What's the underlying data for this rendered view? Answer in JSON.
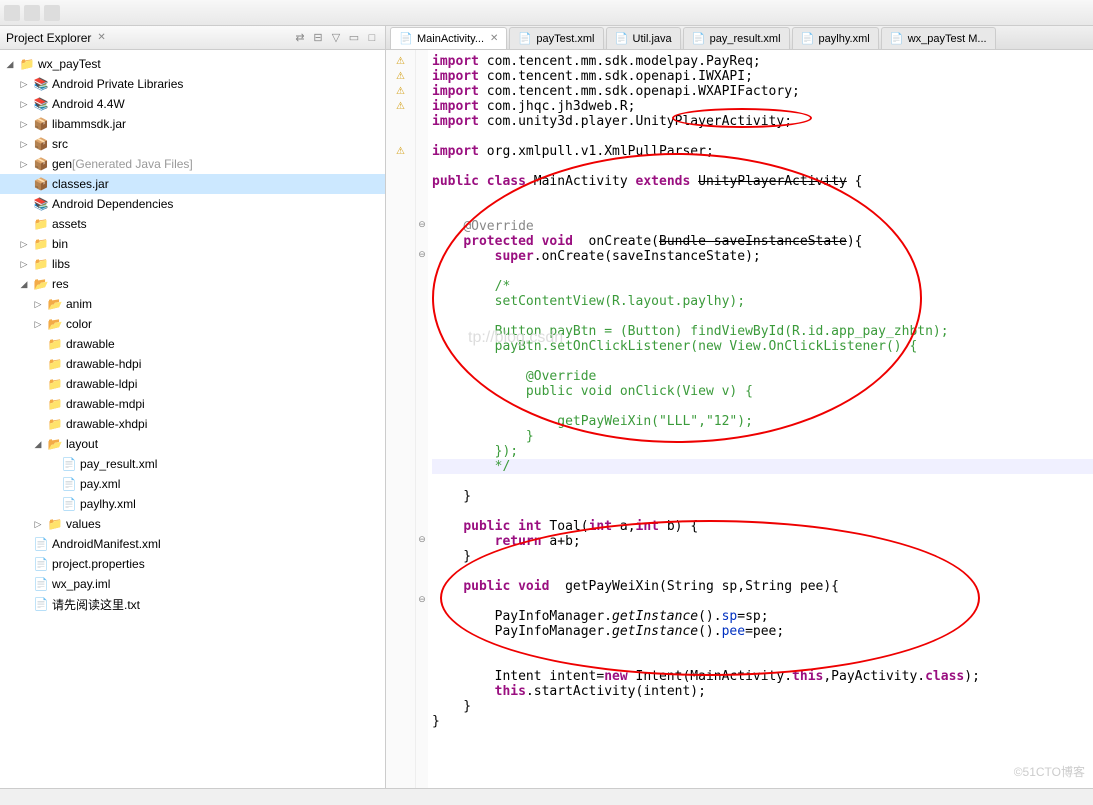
{
  "explorer": {
    "title": "Project Explorer",
    "project": "wx_payTest",
    "items": [
      {
        "label": "Android Private Libraries",
        "indent": 1,
        "toggle": "▷",
        "icon": "📚"
      },
      {
        "label": "Android 4.4W",
        "indent": 1,
        "toggle": "▷",
        "icon": "📚"
      },
      {
        "label": "libammsdk.jar",
        "indent": 1,
        "toggle": "▷",
        "icon": "📦"
      },
      {
        "label": "src",
        "indent": 1,
        "toggle": "▷",
        "icon": "📦"
      },
      {
        "label": "gen",
        "extra": "[Generated Java Files]",
        "indent": 1,
        "toggle": "▷",
        "icon": "📦"
      },
      {
        "label": "classes.jar",
        "indent": 1,
        "toggle": " ",
        "icon": "📦",
        "selected": true
      },
      {
        "label": "Android Dependencies",
        "indent": 1,
        "toggle": " ",
        "icon": "📚"
      },
      {
        "label": "assets",
        "indent": 1,
        "toggle": " ",
        "icon": "📁"
      },
      {
        "label": "bin",
        "indent": 1,
        "toggle": "▷",
        "icon": "📁"
      },
      {
        "label": "libs",
        "indent": 1,
        "toggle": "▷",
        "icon": "📁"
      },
      {
        "label": "res",
        "indent": 1,
        "toggle": "◢",
        "icon": "📂"
      },
      {
        "label": "anim",
        "indent": 2,
        "toggle": "▷",
        "icon": "📂"
      },
      {
        "label": "color",
        "indent": 2,
        "toggle": "▷",
        "icon": "📂"
      },
      {
        "label": "drawable",
        "indent": 2,
        "toggle": " ",
        "icon": "📁"
      },
      {
        "label": "drawable-hdpi",
        "indent": 2,
        "toggle": " ",
        "icon": "📁"
      },
      {
        "label": "drawable-ldpi",
        "indent": 2,
        "toggle": " ",
        "icon": "📁"
      },
      {
        "label": "drawable-mdpi",
        "indent": 2,
        "toggle": " ",
        "icon": "📁"
      },
      {
        "label": "drawable-xhdpi",
        "indent": 2,
        "toggle": " ",
        "icon": "📁"
      },
      {
        "label": "layout",
        "indent": 2,
        "toggle": "◢",
        "icon": "📂"
      },
      {
        "label": "pay_result.xml",
        "indent": 3,
        "toggle": " ",
        "icon": "📄"
      },
      {
        "label": "pay.xml",
        "indent": 3,
        "toggle": " ",
        "icon": "📄"
      },
      {
        "label": "paylhy.xml",
        "indent": 3,
        "toggle": " ",
        "icon": "📄"
      },
      {
        "label": "values",
        "indent": 2,
        "toggle": "▷",
        "icon": "📁"
      },
      {
        "label": "AndroidManifest.xml",
        "indent": 1,
        "toggle": " ",
        "icon": "📄"
      },
      {
        "label": "project.properties",
        "indent": 1,
        "toggle": " ",
        "icon": "📄"
      },
      {
        "label": "wx_pay.iml",
        "indent": 1,
        "toggle": " ",
        "icon": "📄"
      },
      {
        "label": "请先阅读这里.txt",
        "indent": 1,
        "toggle": " ",
        "icon": "📄"
      }
    ]
  },
  "tabs": [
    {
      "label": "MainActivity...",
      "active": true,
      "close": true
    },
    {
      "label": "payTest.xml"
    },
    {
      "label": "Util.java"
    },
    {
      "label": "pay_result.xml"
    },
    {
      "label": "paylhy.xml"
    },
    {
      "label": "wx_payTest M..."
    }
  ],
  "code": {
    "imports": [
      "com.tencent.mm.sdk.modelpay.PayReq",
      "com.tencent.mm.sdk.openapi.IWXAPI",
      "com.tencent.mm.sdk.openapi.WXAPIFactory",
      "com.jhqc.jh3dweb.R",
      "com.unity3d.player.UnityPlayerActivity"
    ],
    "import_xml": "org.xmlpull.v1.XmlPullParser",
    "class_decl": {
      "name": "MainActivity",
      "extends": "UnityPlayerActivity"
    },
    "onCreate_param": "Bundle saveInstanceState",
    "onCreate_super": "super.onCreate(saveInstanceState);",
    "comment_block": [
      "/*",
      "setContentView(R.layout.paylhy);",
      "",
      "Button payBtn = (Button) findViewById(R.id.app_pay_zhbtn);",
      "payBtn.setOnClickListener(new View.OnClickListener() {",
      "",
      "    @Override",
      "    public void onClick(View v) {",
      "",
      "        getPayWeiXin(\"LLL\",\"12\");",
      "    }",
      "});",
      "*/"
    ],
    "toal_sig": "public int Toal(int a,int b) {",
    "toal_body": "return a+b;",
    "getPay_sig": "public void  getPayWeiXin(String sp,String pee){",
    "getPay_l1": "PayInfoManager.getInstance().sp=sp;",
    "getPay_l2": "PayInfoManager.getInstance().pee=pee;",
    "intent_l1": "Intent intent=new Intent(MainActivity.this,PayActivity.class);",
    "intent_l2": "this.startActivity(intent);"
  },
  "watermark": "tp://blog.csdn",
  "watermark2": "©51CTO博客"
}
